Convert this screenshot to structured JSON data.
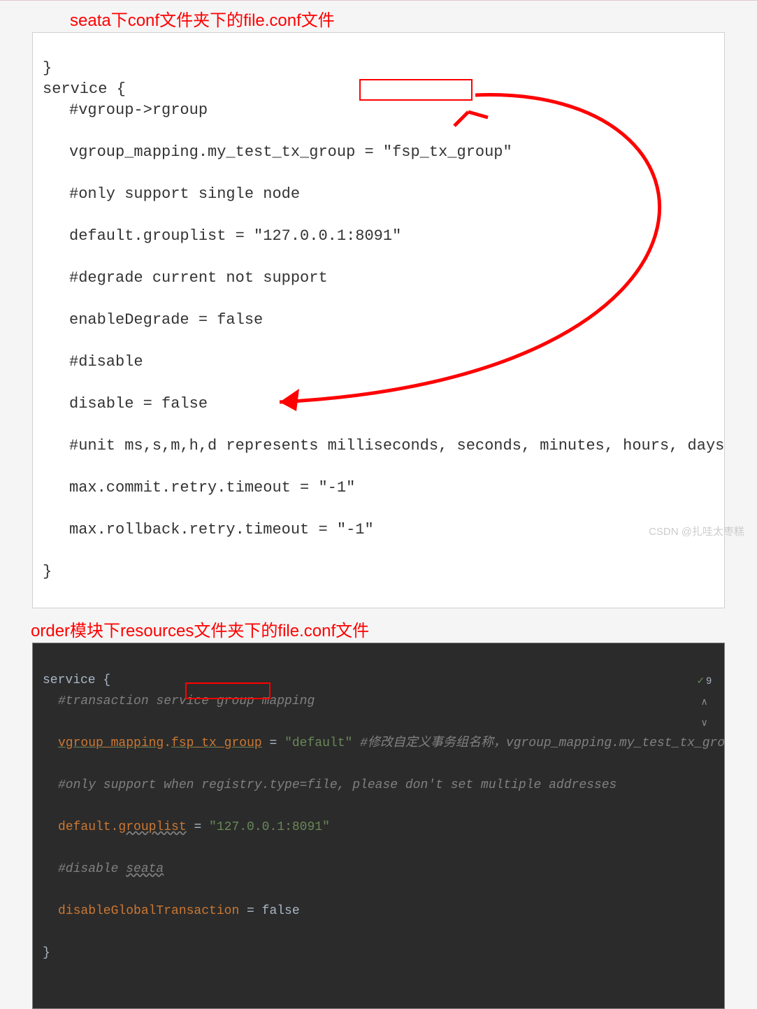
{
  "caption1": "seata下conf文件夹下的file.conf文件",
  "caption2": "order模块下resources文件夹下的file.conf文件",
  "light": {
    "l0": "}",
    "l1": "service {",
    "l2": "#vgroup->rgroup",
    "l3a": "vgroup_mapping.my_test_tx_group = ",
    "l3b": "\"fsp_tx_group\"",
    "l4": "#only support single node",
    "l5": "default.grouplist = \"127.0.0.1:8091\"",
    "l6": "#degrade current not support",
    "l7": "enableDegrade = false",
    "l8": "#disable",
    "l9": "disable = false",
    "l10": "#unit ms,s,m,h,d represents milliseconds, seconds, minutes, hours, days",
    "l11": "max.commit.retry.timeout = \"-1\"",
    "l12": "max.rollback.retry.timeout = \"-1\"",
    "l13": "}"
  },
  "dark": {
    "d0": "service {",
    "d1": "#transaction service group mapping",
    "d2a": "vgroup_mapping",
    "d2b": ".",
    "d2c": "fsp_tx_group",
    "d2d": " = ",
    "d2e": "\"default\"",
    "d2f": " #修改自定义事务组名称，vgroup_mapping.my_test_tx_group",
    "d3": "#only support when registry.type=file, please don't set multiple addresses",
    "d4a": "default.",
    "d4b": "grouplist",
    "d4c": " = ",
    "d4d": "\"127.0.0.1:8091\"",
    "d5a": "#disable ",
    "d5b": "seata",
    "d6a": "disableGlobalTransaction",
    "d6b": " = false",
    "d7": "}"
  },
  "status": {
    "check": "✓",
    "num": "9",
    "up": "∧",
    "down": "∨"
  },
  "footer": "CSDN @扎哇太枣糕"
}
